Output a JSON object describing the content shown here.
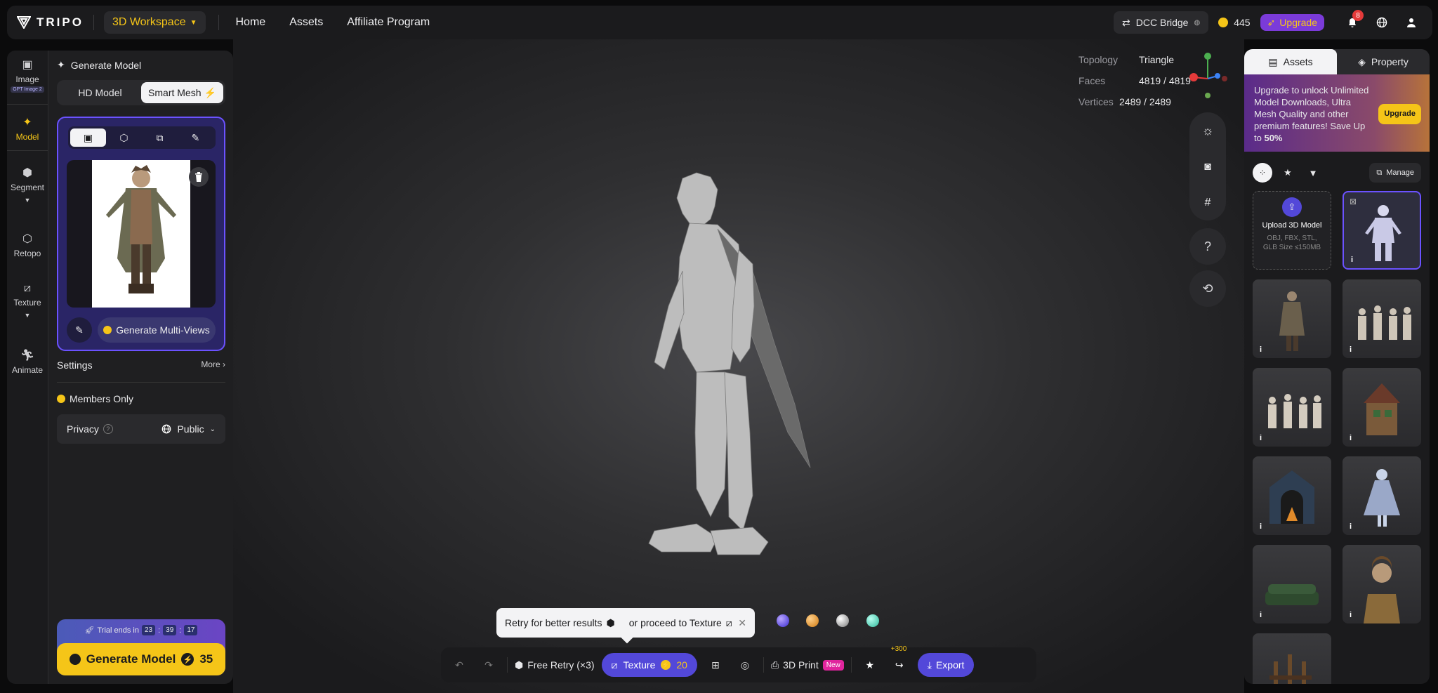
{
  "topbar": {
    "logo_text": "TRIPO",
    "workspace_label": "3D Workspace",
    "nav": [
      "Home",
      "Assets",
      "Affiliate Program"
    ],
    "dcc_label": "DCC Bridge",
    "credits": "445",
    "upgrade_label": "Upgrade",
    "notif_count": "8"
  },
  "rail": {
    "items": [
      {
        "label": "Image",
        "badge": "GPT Image 2"
      },
      {
        "label": "Model"
      },
      {
        "label": "Segment"
      },
      {
        "label": "Retopo"
      },
      {
        "label": "Texture"
      },
      {
        "label": "Animate"
      }
    ]
  },
  "left": {
    "header": "Generate Model",
    "mode_tabs": [
      "HD Model",
      "Smart Mesh"
    ],
    "multi_views_label": "Generate Multi-Views",
    "settings_label": "Settings",
    "more_label": "More",
    "members_label": "Members Only",
    "privacy_label": "Privacy",
    "privacy_value": "Public",
    "trial_label": "Trial ends in",
    "trial_h": "23",
    "trial_m": "39",
    "trial_s": "17",
    "generate_label": "Generate Model",
    "generate_cost": "35"
  },
  "stats": {
    "topology_label": "Topology",
    "topology_value": "Triangle",
    "faces_label": "Faces",
    "faces_value": "4819 / 4819",
    "vertices_label": "Vertices",
    "vertices_value": "2489 / 2489"
  },
  "tooltip": {
    "text1": "Retry for better results",
    "text2": "or proceed to Texture"
  },
  "bottombar": {
    "retry_label": "Free Retry (×3)",
    "texture_label": "Texture",
    "texture_cost": "20",
    "print_label": "3D Print",
    "new_badge": "New",
    "share_bonus": "+300",
    "export_label": "Export"
  },
  "right": {
    "tabs": [
      "Assets",
      "Property"
    ],
    "promo_text": "Upgrade to unlock Unlimited Model Downloads, Ultra Mesh Quality and other premium features!  Save Up to ",
    "promo_pct": "50%",
    "promo_button": "Upgrade",
    "manage_label": "Manage",
    "upload_title": "Upload 3D Model",
    "upload_sub": "OBJ, FBX, STL, GLB Size ≤150MB"
  },
  "colors": {
    "accent_yellow": "#f5c518",
    "accent_purple": "#5348d9",
    "badge_pink": "#e0259d"
  }
}
